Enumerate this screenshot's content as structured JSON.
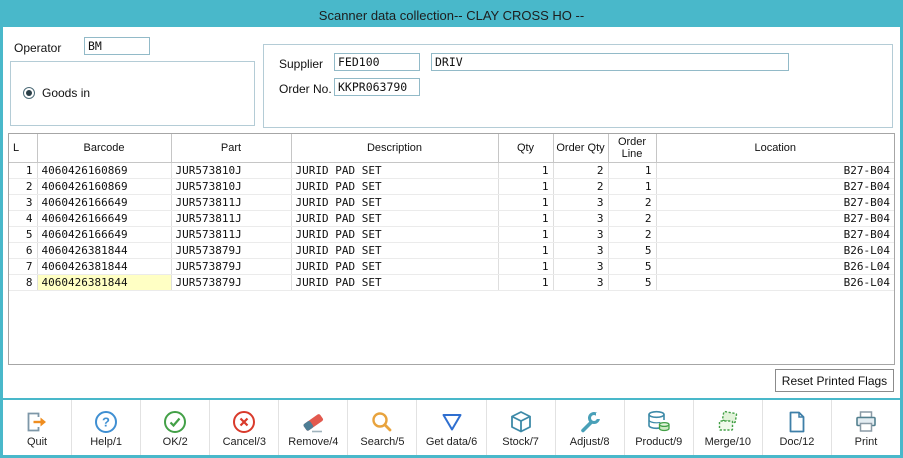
{
  "window": {
    "title": "Scanner data collection-- CLAY CROSS HO --"
  },
  "form": {
    "operator_label": "Operator",
    "operator_value": "BM",
    "goods_in_label": "Goods in",
    "supplier_label": "Supplier",
    "supplier_code": "FED100",
    "supplier_name": "DRIV",
    "order_no_label": "Order No.",
    "order_no_value": "KKPR063790"
  },
  "grid": {
    "columns": [
      "L",
      "Barcode",
      "Part",
      "Description",
      "Qty",
      "Order Qty",
      "Order Line",
      "Location"
    ],
    "rows": [
      {
        "l": "1",
        "barcode": "4060426160869",
        "part": "JUR573810J",
        "description": "JURID PAD SET",
        "qty": "1",
        "order_qty": "2",
        "order_line": "1",
        "location": "B27-B04"
      },
      {
        "l": "2",
        "barcode": "4060426160869",
        "part": "JUR573810J",
        "description": "JURID PAD SET",
        "qty": "1",
        "order_qty": "2",
        "order_line": "1",
        "location": "B27-B04"
      },
      {
        "l": "3",
        "barcode": "4060426166649",
        "part": "JUR573811J",
        "description": "JURID PAD SET",
        "qty": "1",
        "order_qty": "3",
        "order_line": "2",
        "location": "B27-B04"
      },
      {
        "l": "4",
        "barcode": "4060426166649",
        "part": "JUR573811J",
        "description": "JURID PAD SET",
        "qty": "1",
        "order_qty": "3",
        "order_line": "2",
        "location": "B27-B04"
      },
      {
        "l": "5",
        "barcode": "4060426166649",
        "part": "JUR573811J",
        "description": "JURID PAD SET",
        "qty": "1",
        "order_qty": "3",
        "order_line": "2",
        "location": "B27-B04"
      },
      {
        "l": "6",
        "barcode": "4060426381844",
        "part": "JUR573879J",
        "description": "JURID PAD SET",
        "qty": "1",
        "order_qty": "3",
        "order_line": "5",
        "location": "B26-L04"
      },
      {
        "l": "7",
        "barcode": "4060426381844",
        "part": "JUR573879J",
        "description": "JURID PAD SET",
        "qty": "1",
        "order_qty": "3",
        "order_line": "5",
        "location": "B26-L04"
      },
      {
        "l": "8",
        "barcode": "4060426381844",
        "part": "JUR573879J",
        "description": "JURID PAD SET",
        "qty": "1",
        "order_qty": "3",
        "order_line": "5",
        "location": "B26-L04"
      }
    ],
    "highlighted_cell": {
      "row": 8,
      "column": "Barcode"
    }
  },
  "reset_button_label": "Reset Printed Flags",
  "toolbar": {
    "items": [
      {
        "label": "Quit",
        "icon": "exit-door"
      },
      {
        "label": "Help/1",
        "icon": "question-circle"
      },
      {
        "label": "OK/2",
        "icon": "check-circle"
      },
      {
        "label": "Cancel/3",
        "icon": "x-circle"
      },
      {
        "label": "Remove/4",
        "icon": "eraser"
      },
      {
        "label": "Search/5",
        "icon": "magnifier"
      },
      {
        "label": "Get data/6",
        "icon": "down-triangle"
      },
      {
        "label": "Stock/7",
        "icon": "cube"
      },
      {
        "label": "Adjust/8",
        "icon": "wrench"
      },
      {
        "label": "Product/9",
        "icon": "database-coins"
      },
      {
        "label": "Merge/10",
        "icon": "tickets"
      },
      {
        "label": "Doc/12",
        "icon": "document"
      },
      {
        "label": "Print",
        "icon": "printer"
      }
    ]
  },
  "colors": {
    "titlebar": "#49b8ca",
    "border": "#49b8ca",
    "highlight_cell": "#ffffc4",
    "ok_green": "#43a047",
    "cancel_red": "#d93a2b",
    "help_blue": "#3f8fd2",
    "quit_orange": "#ef8d1f"
  }
}
